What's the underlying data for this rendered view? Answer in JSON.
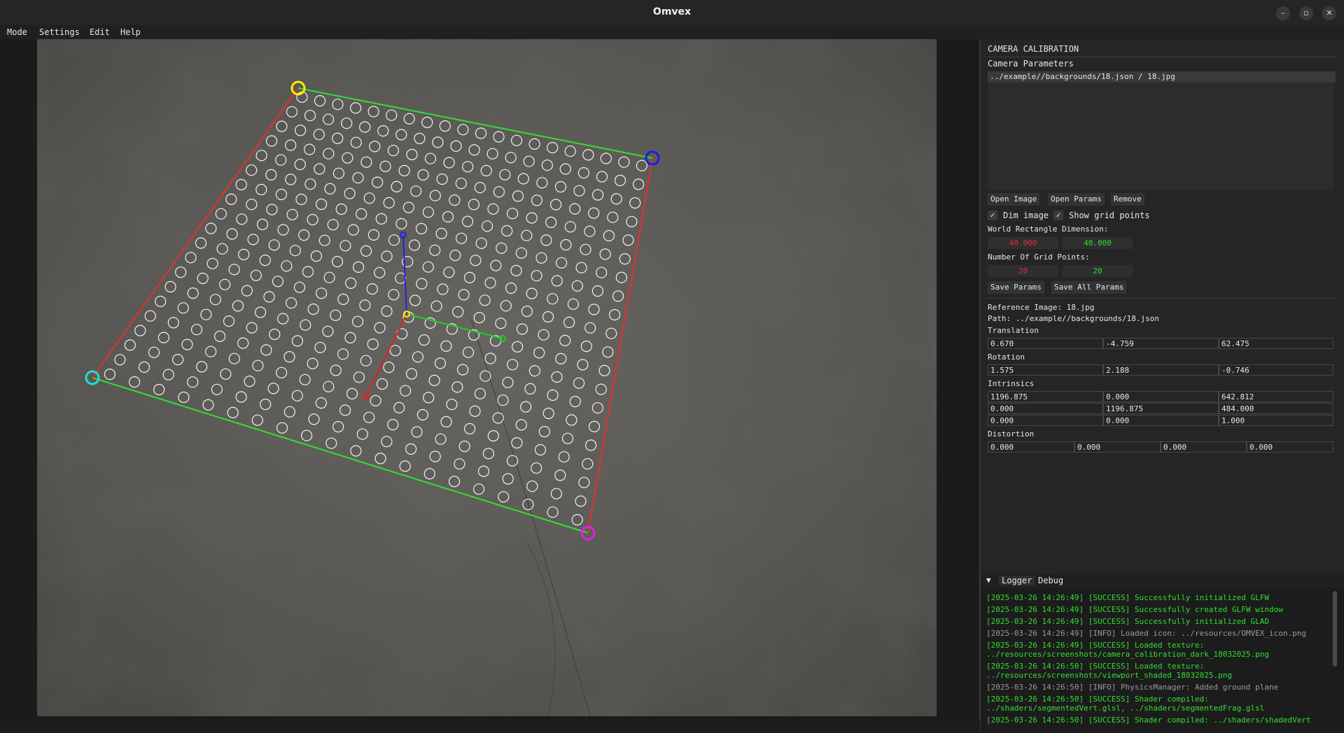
{
  "window": {
    "title": "Omvex"
  },
  "window_controls": {
    "minimize": "–",
    "maximize": "▫",
    "close": "✕"
  },
  "menu": [
    "Mode",
    "Settings",
    "Edit",
    "Help"
  ],
  "panel": {
    "title": "CAMERA CALIBRATION",
    "camera_params_label": "Camera Parameters",
    "selected_item": "../example//backgrounds/18.json / 18.jpg",
    "buttons": {
      "open_image": "Open Image",
      "open_params": "Open Params",
      "remove": "Remove"
    },
    "checkboxes": {
      "dim_image": {
        "label": "Dim image",
        "checked": true,
        "mark": "✓"
      },
      "show_grid": {
        "label": "Show grid points",
        "checked": true,
        "mark": "✓"
      }
    },
    "world_rect_label": "World Rectangle Dimension:",
    "world_rect": {
      "x": "40.000",
      "y": "40.000"
    },
    "grid_points_label": "Number Of Grid Points:",
    "grid_points": {
      "x": "20",
      "y": "20"
    },
    "save_params": "Save Params",
    "save_all_params": "Save All Params",
    "reference_image": "Reference Image: 18.jpg",
    "path": "Path: ../example//backgrounds/18.json",
    "translation_label": "Translation",
    "translation": [
      "0.670",
      "-4.759",
      "62.475"
    ],
    "rotation_label": "Rotation",
    "rotation": [
      "1.575",
      "2.188",
      "-0.746"
    ],
    "intrinsics_label": "Intrinsics",
    "intrinsics": [
      [
        "1196.875",
        "0.000",
        "642.812"
      ],
      [
        "0.000",
        "1196.875",
        "484.000"
      ],
      [
        "0.000",
        "0.000",
        "1.000"
      ]
    ],
    "distortion_label": "Distortion",
    "distortion": [
      "0.000",
      "0.000",
      "0.000",
      "0.000"
    ]
  },
  "logger": {
    "toggle": "▼",
    "tabs": [
      "Logger",
      "Debug"
    ],
    "lines": [
      {
        "text": "[2025-03-26 14:26:49] [SUCCESS] Successfully initialized GLFW",
        "level": "success"
      },
      {
        "text": "[2025-03-26 14:26:49] [SUCCESS] Successfully created GLFW window",
        "level": "success"
      },
      {
        "text": "[2025-03-26 14:26:49] [SUCCESS] Successfully initialized GLAD",
        "level": "success"
      },
      {
        "text": "[2025-03-26 14:26:49] [INFO] Loaded icon: ../resources/OMVEX_icon.png",
        "level": "info"
      },
      {
        "text": "[2025-03-26 14:26:49] [SUCCESS] Loaded texture:\n../resources/screenshots/camera_calibration_dark_18032025.png",
        "level": "success"
      },
      {
        "text": "[2025-03-26 14:26:50] [SUCCESS] Loaded texture:\n../resources/screenshots/viewport_shaded_18032025.png",
        "level": "success"
      },
      {
        "text": "[2025-03-26 14:26:50] [INFO] PhysicsManager: Added ground plane",
        "level": "info"
      },
      {
        "text": "[2025-03-26 14:26:50] [SUCCESS] Shader compiled:\n../shaders/segmentedVert.glsl, ../shaders/segmentedFrag.glsl",
        "level": "success"
      },
      {
        "text": "[2025-03-26 14:26:50] [SUCCESS] Shader compiled: ../shaders/shadedVert",
        "level": "success"
      }
    ]
  },
  "colors": {
    "success": "#33dd33",
    "info": "#9a9a9a",
    "world_x": "#e23030",
    "world_y": "#33dd33",
    "corner_top_left": "#ffee00",
    "corner_top_right": "#1a1aee",
    "corner_bottom_left": "#22dddd",
    "corner_bottom_right": "#dd22dd",
    "axis_x": "#dd2222",
    "axis_y": "#22cc22",
    "axis_z": "#2222dd"
  },
  "overlay": {
    "grid": {
      "rows": 20,
      "cols": 20
    }
  }
}
